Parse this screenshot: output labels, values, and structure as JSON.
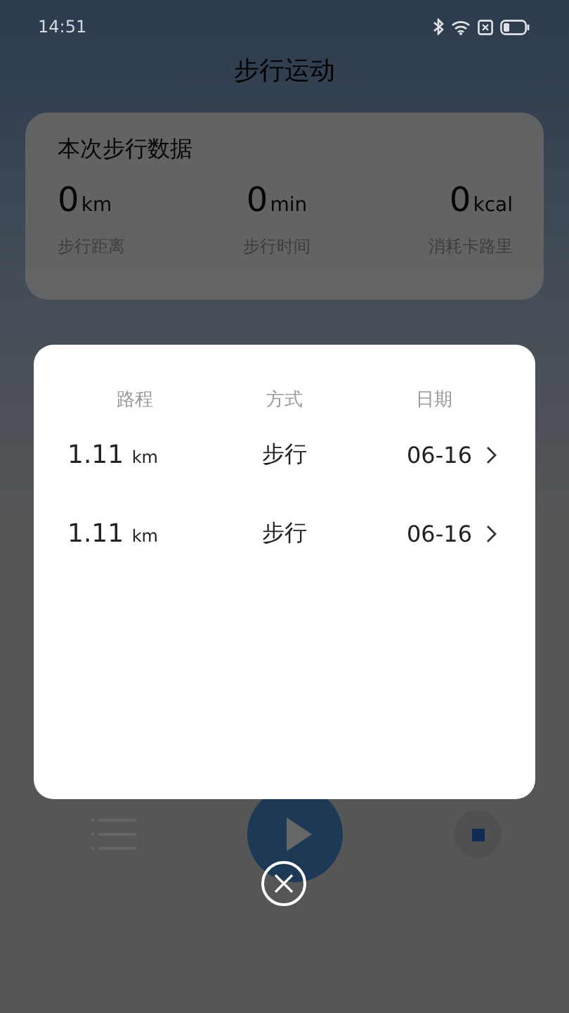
{
  "status_bar": {
    "time": "14:51"
  },
  "title": "步行运动",
  "summary": {
    "title": "本次步行数据",
    "stats": [
      {
        "value": "0",
        "unit": "km",
        "label": "步行距离"
      },
      {
        "value": "0",
        "unit": "min",
        "label": "步行时间"
      },
      {
        "value": "0",
        "unit": "kcal",
        "label": "消耗卡路里"
      }
    ]
  },
  "dialog": {
    "columns": [
      "路程",
      "方式",
      "日期"
    ],
    "rows": [
      {
        "distance": "1.11",
        "unit": "km",
        "mode": "步行",
        "date": "06-16"
      },
      {
        "distance": "1.11",
        "unit": "km",
        "mode": "步行",
        "date": "06-16"
      }
    ]
  }
}
